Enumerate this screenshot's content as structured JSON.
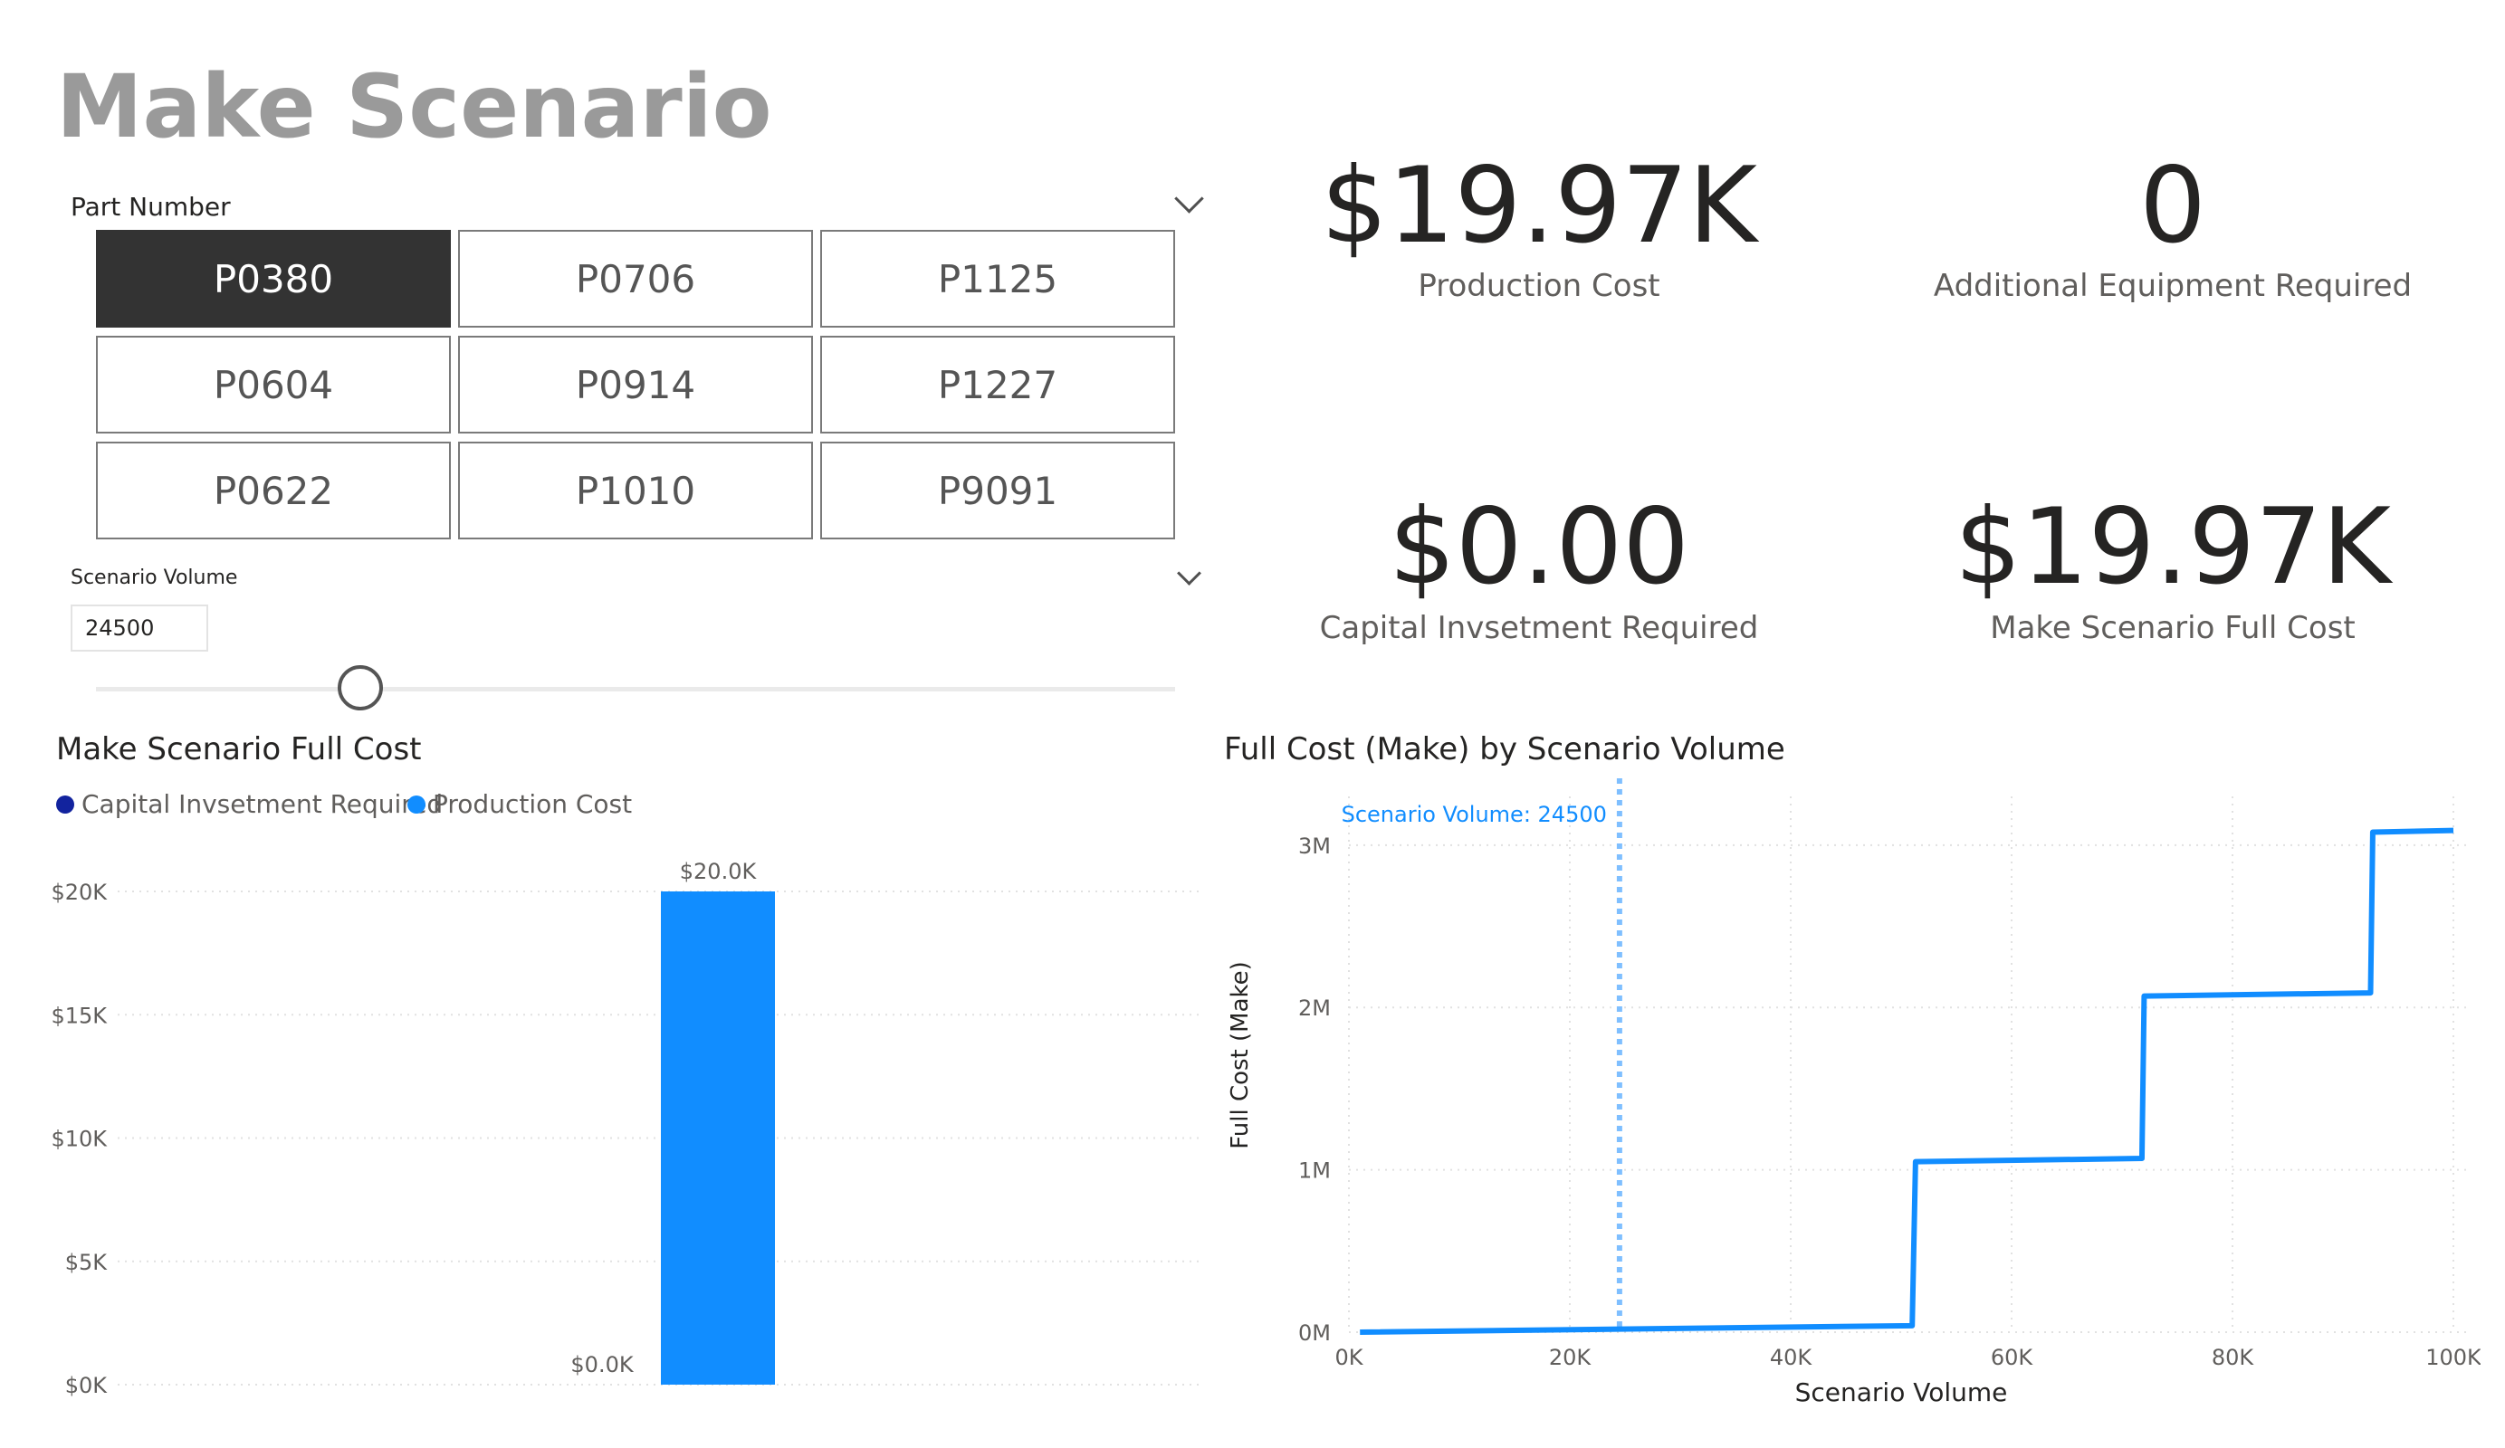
{
  "page": {
    "title": "Make Scenario"
  },
  "part_slicer": {
    "label": "Part Number",
    "items": [
      "P0380",
      "P0706",
      "P1125",
      "P0604",
      "P0914",
      "P1227",
      "P0622",
      "P1010",
      "P9091"
    ],
    "selected": "P0380"
  },
  "volume_slicer": {
    "label": "Scenario Volume",
    "value": "24500",
    "slider_fraction": 0.245
  },
  "cards": {
    "production_cost": {
      "value": "$19.97K",
      "label": "Production Cost"
    },
    "additional_equipment": {
      "value": "0",
      "label": "Additional Equipment Required"
    },
    "capital_investment": {
      "value": "$0.00",
      "label": "Capital Invsetment Required"
    },
    "full_cost": {
      "value": "$19.97K",
      "label": "Make Scenario Full Cost"
    }
  },
  "colors": {
    "production_cost": "#118DFF",
    "capital_investment": "#12239E",
    "reference_line": "#7FBFFF"
  },
  "chart_data": [
    {
      "type": "bar",
      "title": "Make Scenario Full Cost",
      "series": [
        {
          "name": "Capital Invsetment Required",
          "values": [
            0
          ],
          "data_labels": [
            "$0.0K"
          ]
        },
        {
          "name": "Production Cost",
          "values": [
            20.0
          ],
          "data_labels": [
            "$20.0K"
          ]
        }
      ],
      "y_ticks": [
        "$0K",
        "$5K",
        "$10K",
        "$15K",
        "$20K"
      ],
      "ylim": [
        0,
        20
      ],
      "legend": "top-left",
      "grid": true
    },
    {
      "type": "line",
      "title": "Full Cost (Make) by Scenario Volume",
      "xlabel": "Scenario Volume",
      "ylabel": "Full Cost (Make)",
      "x_ticks": [
        "0K",
        "20K",
        "40K",
        "60K",
        "80K",
        "100K"
      ],
      "y_ticks": [
        "0M",
        "1M",
        "2M",
        "3M"
      ],
      "xlim": [
        0,
        100000
      ],
      "ylim": [
        0,
        3.3
      ],
      "x": [
        1000,
        51000,
        51300,
        71800,
        72000,
        92500,
        92700,
        100000
      ],
      "y": [
        0.0,
        0.04,
        1.05,
        1.07,
        2.07,
        2.09,
        3.08,
        3.09
      ],
      "reference_line": {
        "x": 24500,
        "label": "Scenario Volume: 24500"
      },
      "grid": true
    }
  ]
}
